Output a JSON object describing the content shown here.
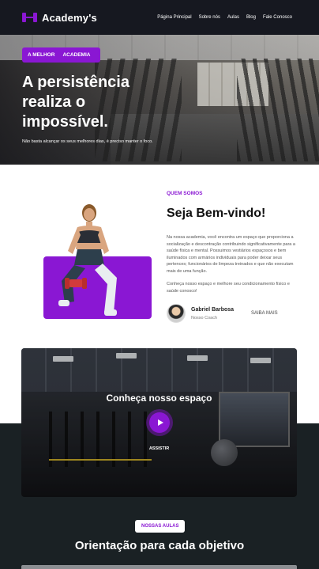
{
  "nav": {
    "brand": "Academy's",
    "items": [
      "Página Principal",
      "Sobre nós",
      "Aulas",
      "Blog",
      "Fale Conosco"
    ]
  },
  "hero": {
    "badge_left": "A MELHOR",
    "badge_right": "ACADEMIA",
    "title": "A persistência realiza o impossível.",
    "subtitle": "Não basta alcançar os seus melhores dias, é preciso manter o foco."
  },
  "about": {
    "label": "QUEM SOMOS",
    "title": "Seja Bem-vindo!",
    "text": "Na nossa academia, você encontra um espaço que proporciona a socialização e descontração contribuindo significativamente para a saúde física e mental. Possuimos vestiários espaçosos e bem iluminados com armários individuais para poder deixar seus pertences; funcionários de limpeza treinados e que não executam mais de uma função.",
    "text2": "Conheça nosso espaço e melhore seu condicionamento físico e saúde conosco!",
    "coach_name": "Gabriel Barbosa",
    "coach_role": "Nosso Coach",
    "more": "SAIBA MAIS"
  },
  "video": {
    "title": "Conheça nosso espaço",
    "play_label": "ASSISTIR"
  },
  "classes": {
    "label": "NOSSAS AULAS",
    "title": "Orientação para cada objetivo"
  },
  "colors": {
    "accent": "#8a17d3",
    "nav_bg": "#161820",
    "dark_band": "#1a2124"
  }
}
